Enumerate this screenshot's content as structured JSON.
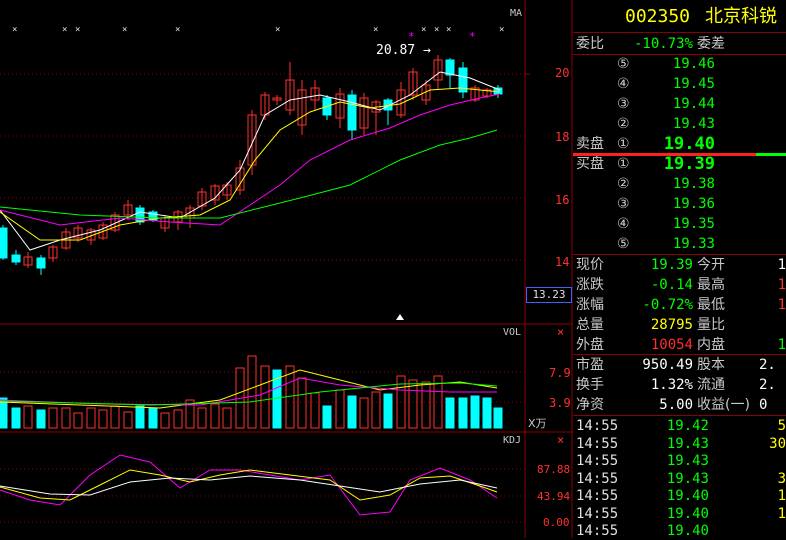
{
  "colors": {
    "up": "#ff3030",
    "down": "#00ffff",
    "flat": "#00ff00",
    "yellow": "#ffff00",
    "grid": "#8b0000",
    "ma5": "#ffffff",
    "ma10": "#ffff00",
    "ma20": "#ff00ff",
    "ma60": "#00ff00",
    "label": "#c8c8c8"
  },
  "price_chart": {
    "indicator_label": "MA",
    "axis_labels": [
      "20",
      "18",
      "16",
      "14"
    ],
    "current_price_tag": "13.23",
    "high_annotation": "20.87 →",
    "marker_symbol": "×",
    "star_symbol": "*"
  },
  "vol_chart": {
    "indicator_label": "VOL",
    "axis_labels": [
      "7.9",
      "3.9"
    ],
    "unit": "X万",
    "close_symbol": "×"
  },
  "kdj_chart": {
    "indicator_label": "KDJ",
    "axis_labels": [
      "87.88",
      "43.94",
      "0.00"
    ],
    "close_symbol": "×"
  },
  "quote": {
    "code": "002350",
    "name": "北京科锐",
    "weibi_label": "委比",
    "weibi_value": "-10.73%",
    "weicha_label": "委差",
    "sell_label": "卖盘",
    "buy_label": "买盘",
    "sell_levels": [
      {
        "idx": "⑤",
        "price": "19.46"
      },
      {
        "idx": "④",
        "price": "19.45"
      },
      {
        "idx": "③",
        "price": "19.44"
      },
      {
        "idx": "②",
        "price": "19.43"
      },
      {
        "idx": "①",
        "price": "19.40"
      }
    ],
    "buy_levels": [
      {
        "idx": "①",
        "price": "19.39"
      },
      {
        "idx": "②",
        "price": "19.38"
      },
      {
        "idx": "③",
        "price": "19.36"
      },
      {
        "idx": "④",
        "price": "19.35"
      },
      {
        "idx": "⑤",
        "price": "19.33"
      }
    ],
    "stats": [
      {
        "l1": "现价",
        "v1": "19.39",
        "c1": "#00ff00",
        "l2": "今开",
        "v2": "1",
        "c2": "#ffffff"
      },
      {
        "l1": "涨跌",
        "v1": "-0.14",
        "c1": "#00ff00",
        "l2": "最高",
        "v2": "1",
        "c2": "#ff3030"
      },
      {
        "l1": "涨幅",
        "v1": "-0.72%",
        "c1": "#00ff00",
        "l2": "最低",
        "v2": "1",
        "c2": "#ff3030"
      },
      {
        "l1": "总量",
        "v1": "28795",
        "c1": "#ffff00",
        "l2": "量比",
        "v2": "",
        "c2": "#ffffff"
      },
      {
        "l1": "外盘",
        "v1": "10054",
        "c1": "#ff3030",
        "l2": "内盘",
        "v2": "1",
        "c2": "#00ff00"
      }
    ],
    "fin": [
      {
        "l1": "市盈",
        "v1": "950.49",
        "l2": "股本",
        "v2": "2."
      },
      {
        "l1": "换手",
        "v1": "1.32%",
        "l2": "流通",
        "v2": "2."
      },
      {
        "l1": "净资",
        "v1": "5.00",
        "l2": "收益(一)",
        "v2": "0"
      }
    ],
    "ticks": [
      {
        "time": "14:55",
        "price": "19.42",
        "vol": "5",
        "vc": "#ffff00"
      },
      {
        "time": "14:55",
        "price": "19.43",
        "vol": "30",
        "vc": "#ffff00"
      },
      {
        "time": "14:55",
        "price": "19.43",
        "vol": "",
        "vc": "#ffff00"
      },
      {
        "time": "14:55",
        "price": "19.43",
        "vol": "3",
        "vc": "#ffff00"
      },
      {
        "time": "14:55",
        "price": "19.40",
        "vol": "1",
        "vc": "#ffff00"
      },
      {
        "time": "14:55",
        "price": "19.40",
        "vol": "1",
        "vc": "#ffff00"
      },
      {
        "time": "14:55",
        "price": "19.40",
        "vol": "",
        "vc": "#ffff00"
      }
    ]
  }
}
